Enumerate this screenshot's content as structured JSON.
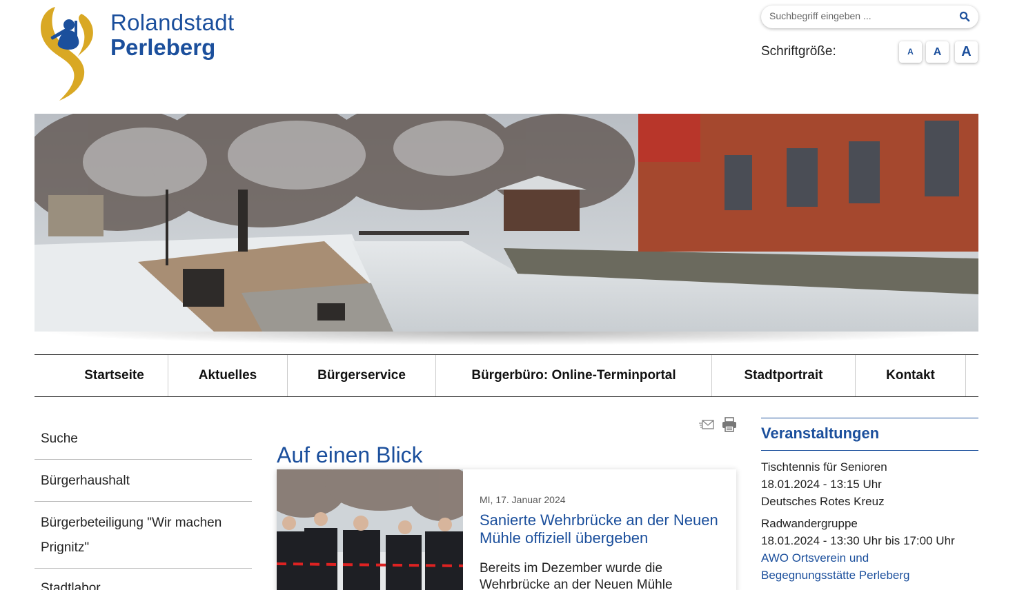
{
  "header": {
    "logo_line1": "Rolandstadt",
    "logo_line2": "Perleberg",
    "search_placeholder": "Suchbegriff eingeben ...",
    "fontsize_label": "Schriftgröße:",
    "fontsize_buttons": [
      "A",
      "A",
      "A"
    ]
  },
  "hero": {
    "slide_count": 7,
    "active_slide": 1
  },
  "nav": {
    "items": [
      {
        "label": "Startseite"
      },
      {
        "label": "Aktuelles"
      },
      {
        "label": "Bürgerservice"
      },
      {
        "label": "Bürgerbüro: Online-Terminportal"
      },
      {
        "label": "Stadtportrait"
      },
      {
        "label": "Kontakt"
      }
    ]
  },
  "sidebar": {
    "items": [
      {
        "label": "Suche"
      },
      {
        "label": "Bürgerhaushalt"
      },
      {
        "label": "Bürgerbeteiligung \"Wir machen Prignitz\""
      },
      {
        "label": "Stadtlabor"
      }
    ]
  },
  "main": {
    "title": "Auf einen Blick",
    "news": {
      "date": "MI, 17. Januar 2024",
      "headline": "Sanierte Wehrbrücke an der Neuen Mühle offiziell übergeben",
      "teaser": "Bereits im Dezember wurde die Wehrbrücke an der Neuen Mühle"
    }
  },
  "events": {
    "title": "Veranstaltungen",
    "items": [
      {
        "name": "Tischtennis für Senioren",
        "time": "18.01.2024 - 13:15 Uhr",
        "location": "Deutsches Rotes Kreuz",
        "location_is_link": false
      },
      {
        "name": "Radwandergruppe",
        "time": "18.01.2024 - 13:30 Uhr bis 17:00 Uhr",
        "location": "AWO Ortsverein und Begegnungsstätte Perleberg",
        "location_is_link": true
      }
    ]
  },
  "colors": {
    "brand_blue": "#1b4f9c",
    "logo_gold": "#d9a824"
  }
}
